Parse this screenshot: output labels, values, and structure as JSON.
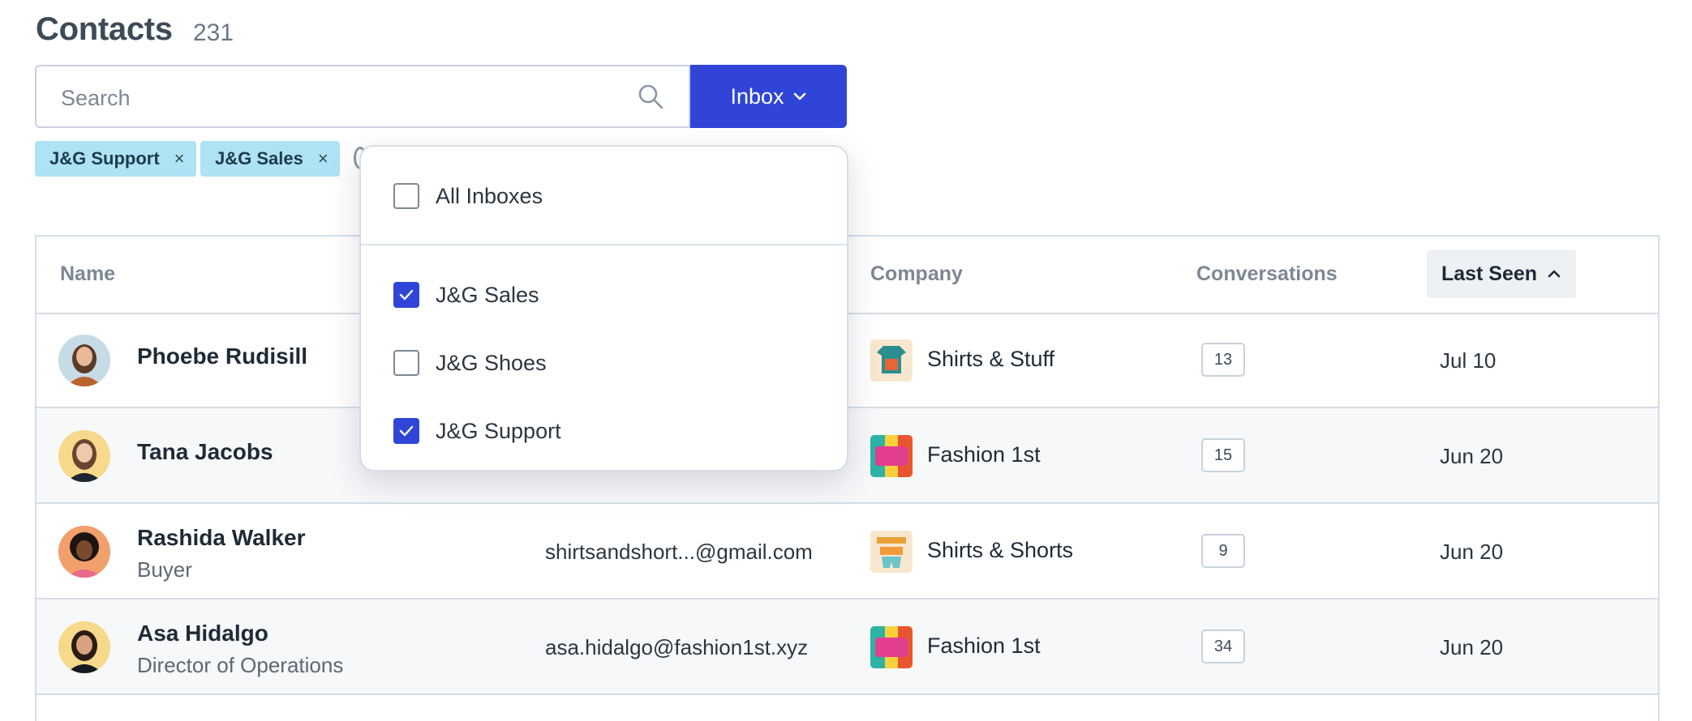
{
  "header": {
    "title": "Contacts",
    "count": "231"
  },
  "search": {
    "placeholder": "Search",
    "icon": "search-icon"
  },
  "inbox_button": {
    "label": "Inbox",
    "icon": "chevron-down-icon",
    "color": "#3045d8"
  },
  "filter_chips": [
    {
      "label": "J&G Support",
      "remove": "×"
    },
    {
      "label": "J&G Sales",
      "remove": "×"
    }
  ],
  "table": {
    "columns": {
      "name": "Name",
      "company": "Company",
      "conversations": "Conversations",
      "last_seen": "Last Seen"
    },
    "sort": {
      "column": "last_seen",
      "icon": "chevron-up-icon"
    },
    "rows": [
      {
        "name": "Phoebe Rudisill",
        "role": "",
        "email": "",
        "company": "Shirts & Stuff",
        "company_logo_text": "SHIRTS & STUFF",
        "conversations": "13",
        "last_seen": "Jul 10"
      },
      {
        "name": "Tana Jacobs",
        "role": "",
        "email": "",
        "company": "Fashion 1st",
        "company_logo_text": "FASHION 1ST",
        "conversations": "15",
        "last_seen": "Jun 20"
      },
      {
        "name": "Rashida Walker",
        "role": "Buyer",
        "email": "shirtsandshort...@gmail.com",
        "company": "Shirts & Shorts",
        "company_logo_text": "SHIRTS & SHORTS",
        "conversations": "9",
        "last_seen": "Jun 20"
      },
      {
        "name": "Asa Hidalgo",
        "role": "Director of Operations",
        "email": "asa.hidalgo@fashion1st.xyz",
        "company": "Fashion 1st",
        "company_logo_text": "FASHION 1ST",
        "conversations": "34",
        "last_seen": "Jun 20"
      }
    ]
  },
  "inbox_dropdown": {
    "items": [
      {
        "label": "All Inboxes",
        "checked": false
      },
      {
        "label": "J&G Sales",
        "checked": true
      },
      {
        "label": "J&G Shoes",
        "checked": false
      },
      {
        "label": "J&G Support",
        "checked": true
      }
    ]
  }
}
